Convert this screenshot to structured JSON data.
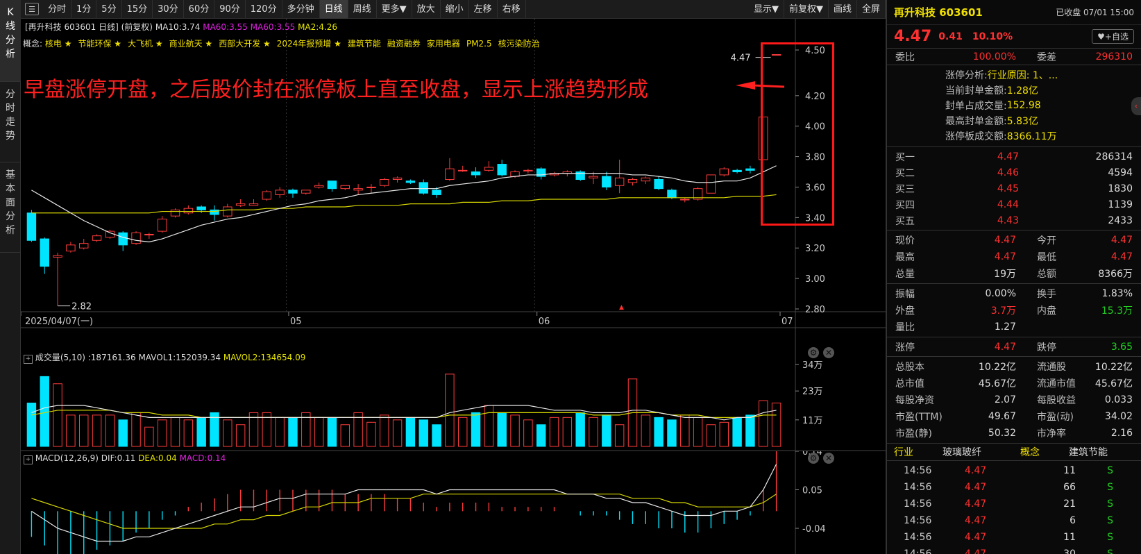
{
  "side_tabs": [
    "K线分析",
    "分时走势",
    "基本面分析"
  ],
  "toolbar": {
    "left_items": [
      "分时",
      "1分",
      "5分",
      "15分",
      "30分",
      "60分",
      "90分",
      "120分",
      "多分钟",
      "日线",
      "周线",
      "更多▼",
      "放大",
      "缩小",
      "左移",
      "右移"
    ],
    "active": "日线",
    "right_items": [
      "显示▼",
      "前复权▼",
      "画线",
      "全屏"
    ]
  },
  "stock_title": {
    "prefix": "[再升科技 603601 日线] (前复权)",
    "ma10": "MA10:3.74",
    "ma60": "MA60:3.55",
    "ma60b": "MA60:3.55",
    "ma2": "MA2:4.26"
  },
  "concepts": {
    "label": "概念:",
    "items": [
      "核电 ★",
      "节能环保 ★",
      "大飞机 ★",
      "商业航天 ★",
      "西部大开发 ★",
      "2024年报预增 ★",
      "建筑节能",
      "融资融券",
      "家用电器",
      "PM2.5",
      "核污染防治"
    ]
  },
  "annotation": "早盘涨停开盘，之后股价封在涨停板上直至收盘，显示上涨趋势形成",
  "price_axis": [
    "4.50",
    "4.20",
    "4.00",
    "3.80",
    "3.60",
    "3.40",
    "3.20",
    "3.00",
    "2.80"
  ],
  "date_axis": [
    "2025/04/07(一)",
    "05",
    "06",
    "07"
  ],
  "markers": {
    "high": "4.47",
    "low": "2.82"
  },
  "colors": {
    "up": "#ff3c3c",
    "down": "#00e5ff",
    "ma10": "#e8e8e8",
    "ma60": "#d6d600",
    "highlight": "#ff1818"
  },
  "volume_panel": {
    "label": "成交量(5,10)",
    "vol": ":187161.36",
    "mavol1": "MAVOL1:152039.34",
    "mavol2": "MAVOL2:134654.09",
    "axis": [
      "34万",
      "23万",
      "11万"
    ]
  },
  "macd_panel": {
    "label": "MACD(12,26,9)",
    "dif": "DIF:0.11",
    "dea": "DEA:0.04",
    "macd": "MACD:0.14",
    "axis": [
      "0.14",
      "0.05",
      "-0.04"
    ]
  },
  "chart_data": {
    "type": "candlestick",
    "ohlc": [
      [
        3.43,
        3.45,
        3.24,
        3.25
      ],
      [
        3.26,
        3.27,
        3.03,
        3.08
      ],
      [
        3.14,
        3.17,
        2.82,
        3.15
      ],
      [
        3.18,
        3.24,
        3.17,
        3.22
      ],
      [
        3.2,
        3.26,
        3.19,
        3.23
      ],
      [
        3.25,
        3.29,
        3.24,
        3.28
      ],
      [
        3.27,
        3.32,
        3.26,
        3.31
      ],
      [
        3.3,
        3.31,
        3.18,
        3.22
      ],
      [
        3.23,
        3.31,
        3.22,
        3.3
      ],
      [
        3.29,
        3.3,
        3.26,
        3.29
      ],
      [
        3.31,
        3.41,
        3.3,
        3.39
      ],
      [
        3.41,
        3.46,
        3.4,
        3.45
      ],
      [
        3.43,
        3.48,
        3.42,
        3.46
      ],
      [
        3.47,
        3.48,
        3.43,
        3.45
      ],
      [
        3.45,
        3.48,
        3.38,
        3.42
      ],
      [
        3.41,
        3.49,
        3.4,
        3.47
      ],
      [
        3.48,
        3.52,
        3.47,
        3.49
      ],
      [
        3.48,
        3.52,
        3.48,
        3.49
      ],
      [
        3.52,
        3.58,
        3.51,
        3.57
      ],
      [
        3.55,
        3.6,
        3.53,
        3.58
      ],
      [
        3.58,
        3.59,
        3.53,
        3.56
      ],
      [
        3.56,
        3.58,
        3.55,
        3.58
      ],
      [
        3.6,
        3.63,
        3.59,
        3.61
      ],
      [
        3.64,
        3.63,
        3.57,
        3.59
      ],
      [
        3.59,
        3.61,
        3.58,
        3.61
      ],
      [
        3.58,
        3.62,
        3.55,
        3.59
      ],
      [
        3.6,
        3.62,
        3.56,
        3.6
      ],
      [
        3.61,
        3.66,
        3.6,
        3.65
      ],
      [
        3.65,
        3.67,
        3.63,
        3.66
      ],
      [
        3.64,
        3.65,
        3.62,
        3.63
      ],
      [
        3.63,
        3.65,
        3.55,
        3.56
      ],
      [
        3.58,
        3.6,
        3.53,
        3.55
      ],
      [
        3.65,
        3.79,
        3.64,
        3.72
      ],
      [
        3.71,
        3.74,
        3.7,
        3.71
      ],
      [
        3.7,
        3.73,
        3.66,
        3.68
      ],
      [
        3.71,
        3.77,
        3.7,
        3.73
      ],
      [
        3.75,
        3.78,
        3.67,
        3.68
      ],
      [
        3.67,
        3.71,
        3.66,
        3.7
      ],
      [
        3.71,
        3.72,
        3.69,
        3.71
      ],
      [
        3.72,
        3.73,
        3.65,
        3.67
      ],
      [
        3.68,
        3.7,
        3.67,
        3.69
      ],
      [
        3.69,
        3.71,
        3.67,
        3.7
      ],
      [
        3.7,
        3.71,
        3.64,
        3.65
      ],
      [
        3.66,
        3.7,
        3.62,
        3.67
      ],
      [
        3.67,
        3.7,
        3.58,
        3.6
      ],
      [
        3.61,
        3.78,
        3.56,
        3.66
      ],
      [
        3.63,
        3.66,
        3.61,
        3.65
      ],
      [
        3.64,
        3.67,
        3.62,
        3.66
      ],
      [
        3.65,
        3.67,
        3.58,
        3.59
      ],
      [
        3.58,
        3.59,
        3.52,
        3.53
      ],
      [
        3.52,
        3.53,
        3.5,
        3.52
      ],
      [
        3.52,
        3.6,
        3.51,
        3.59
      ],
      [
        3.56,
        3.68,
        3.56,
        3.68
      ],
      [
        3.68,
        3.73,
        3.67,
        3.72
      ],
      [
        3.71,
        3.72,
        3.69,
        3.7
      ],
      [
        3.72,
        3.74,
        3.69,
        3.71
      ],
      [
        3.78,
        4.06,
        3.78,
        4.06
      ],
      [
        4.47,
        4.47,
        4.47,
        4.47
      ]
    ],
    "ma10": [
      3.58,
      3.53,
      3.48,
      3.43,
      3.38,
      3.34,
      3.3,
      3.27,
      3.25,
      3.24,
      3.26,
      3.29,
      3.32,
      3.35,
      3.37,
      3.39,
      3.4,
      3.42,
      3.44,
      3.46,
      3.48,
      3.49,
      3.51,
      3.52,
      3.53,
      3.55,
      3.56,
      3.57,
      3.58,
      3.59,
      3.59,
      3.59,
      3.61,
      3.62,
      3.63,
      3.64,
      3.66,
      3.67,
      3.68,
      3.68,
      3.69,
      3.69,
      3.69,
      3.69,
      3.69,
      3.69,
      3.68,
      3.68,
      3.67,
      3.66,
      3.64,
      3.63,
      3.63,
      3.64,
      3.64,
      3.66,
      3.7,
      3.74
    ],
    "ma60": [
      3.43,
      3.43,
      3.43,
      3.43,
      3.43,
      3.43,
      3.43,
      3.43,
      3.43,
      3.43,
      3.44,
      3.44,
      3.44,
      3.44,
      3.44,
      3.45,
      3.45,
      3.45,
      3.46,
      3.46,
      3.46,
      3.47,
      3.47,
      3.47,
      3.47,
      3.48,
      3.48,
      3.48,
      3.48,
      3.49,
      3.49,
      3.49,
      3.49,
      3.5,
      3.5,
      3.5,
      3.51,
      3.51,
      3.51,
      3.52,
      3.52,
      3.52,
      3.52,
      3.52,
      3.52,
      3.53,
      3.53,
      3.53,
      3.53,
      3.53,
      3.53,
      3.53,
      3.53,
      3.53,
      3.54,
      3.54,
      3.54,
      3.55
    ],
    "volume": [
      18,
      29,
      26,
      13,
      13,
      13,
      13,
      11,
      14,
      8,
      11,
      12,
      11,
      12,
      14,
      11,
      9,
      14,
      14,
      12,
      12,
      14,
      12,
      12,
      9,
      14,
      10,
      13,
      11,
      12,
      11,
      9,
      30,
      12,
      14,
      17,
      14,
      13,
      11,
      9,
      12,
      12,
      14,
      12,
      13,
      9,
      28,
      13,
      12,
      11,
      13,
      12,
      9,
      10,
      12,
      13,
      19,
      18
    ],
    "mavol1": [
      14,
      16,
      17,
      17,
      17,
      16,
      15,
      14,
      13,
      12,
      12,
      12,
      12,
      12,
      12,
      12,
      12,
      12,
      12,
      12,
      12,
      12,
      12,
      12,
      12,
      12,
      12,
      12,
      12,
      12,
      12,
      12,
      14,
      15,
      16,
      17,
      17,
      17,
      17,
      16,
      15,
      15,
      15,
      14,
      14,
      14,
      15,
      15,
      14,
      13,
      12,
      12,
      12,
      11,
      12,
      12,
      14,
      15
    ],
    "mavol2": [
      13,
      14,
      15,
      15,
      15,
      15,
      15,
      14,
      14,
      14,
      13,
      13,
      13,
      12,
      12,
      12,
      12,
      12,
      12,
      12,
      12,
      12,
      12,
      12,
      12,
      12,
      12,
      12,
      12,
      12,
      12,
      12,
      13,
      13,
      13,
      14,
      14,
      14,
      14,
      14,
      14,
      14,
      14,
      13,
      13,
      13,
      14,
      14,
      14,
      13,
      13,
      13,
      12,
      12,
      12,
      12,
      13,
      13
    ],
    "dif": [
      0.0,
      -0.02,
      -0.04,
      -0.05,
      -0.06,
      -0.07,
      -0.07,
      -0.07,
      -0.06,
      -0.06,
      -0.05,
      -0.04,
      -0.03,
      -0.02,
      -0.01,
      -0.0,
      0.01,
      0.01,
      0.02,
      0.03,
      0.03,
      0.04,
      0.04,
      0.04,
      0.04,
      0.05,
      0.05,
      0.05,
      0.05,
      0.05,
      0.05,
      0.04,
      0.05,
      0.05,
      0.05,
      0.05,
      0.05,
      0.05,
      0.05,
      0.05,
      0.05,
      0.04,
      0.04,
      0.04,
      0.03,
      0.03,
      0.02,
      0.02,
      0.01,
      0.0,
      -0.01,
      -0.01,
      -0.01,
      0.0,
      0.0,
      0.01,
      0.05,
      0.11
    ],
    "dea": [
      0.03,
      0.02,
      0.01,
      -0.0,
      -0.01,
      -0.02,
      -0.03,
      -0.04,
      -0.04,
      -0.04,
      -0.04,
      -0.04,
      -0.04,
      -0.04,
      -0.03,
      -0.03,
      -0.02,
      -0.02,
      -0.01,
      -0.01,
      0.0,
      0.01,
      0.01,
      0.02,
      0.02,
      0.02,
      0.03,
      0.03,
      0.03,
      0.03,
      0.04,
      0.04,
      0.04,
      0.04,
      0.04,
      0.04,
      0.04,
      0.04,
      0.04,
      0.04,
      0.04,
      0.04,
      0.04,
      0.04,
      0.04,
      0.04,
      0.03,
      0.03,
      0.03,
      0.02,
      0.02,
      0.01,
      0.01,
      0.01,
      0.01,
      0.01,
      0.02,
      0.04
    ],
    "macd": [
      -0.06,
      -0.08,
      -0.1,
      -0.1,
      -0.1,
      -0.09,
      -0.08,
      -0.07,
      -0.05,
      -0.04,
      -0.02,
      -0.01,
      0.01,
      0.02,
      0.03,
      0.04,
      0.05,
      0.05,
      0.05,
      0.05,
      0.05,
      0.05,
      0.05,
      0.05,
      0.04,
      0.04,
      0.04,
      0.04,
      0.03,
      0.03,
      0.02,
      0.01,
      0.02,
      0.02,
      0.02,
      0.02,
      0.01,
      0.01,
      0.01,
      0.01,
      0.01,
      0.0,
      -0.01,
      -0.01,
      -0.01,
      -0.02,
      -0.03,
      -0.03,
      -0.04,
      -0.04,
      -0.05,
      -0.05,
      -0.04,
      -0.03,
      -0.02,
      -0.01,
      0.05,
      0.14
    ],
    "ylim_price": [
      2.8,
      4.5
    ],
    "ylim_volume": [
      0,
      34
    ],
    "ylim_macd": [
      -0.1,
      0.14
    ]
  },
  "quote": {
    "name": "再升科技 603601",
    "status": "已收盘 07/01 15:00",
    "price": "4.47",
    "change": "0.41",
    "pct": "10.10%",
    "watch": "♥+自选",
    "weibi_label": "委比",
    "weibi": "100.00%",
    "weicha_label": "委差",
    "weicha": "296310",
    "limit_up": [
      {
        "label": "涨停分析:",
        "value": "行业原因: 1、..."
      },
      {
        "label": "当前封单金额:",
        "value": "1.28亿"
      },
      {
        "label": "封单占成交量:",
        "value": "152.98"
      },
      {
        "label": "最高封单金额:",
        "value": "5.83亿"
      },
      {
        "label": "涨停板成交额:",
        "value": "8366.11万"
      }
    ],
    "orderbook": [
      {
        "label": "买一",
        "price": "4.47",
        "vol": "286314"
      },
      {
        "label": "买二",
        "price": "4.46",
        "vol": "4594"
      },
      {
        "label": "买三",
        "price": "4.45",
        "vol": "1830"
      },
      {
        "label": "买四",
        "price": "4.44",
        "vol": "1139"
      },
      {
        "label": "买五",
        "price": "4.43",
        "vol": "2433"
      }
    ],
    "stats": [
      {
        "l1": "现价",
        "v1": "4.47",
        "c1": "red",
        "l2": "今开",
        "v2": "4.47",
        "c2": "red"
      },
      {
        "l1": "最高",
        "v1": "4.47",
        "c1": "red",
        "l2": "最低",
        "v2": "4.47",
        "c2": "red"
      },
      {
        "l1": "总量",
        "v1": "19万",
        "c1": "white",
        "l2": "总额",
        "v2": "8366万",
        "c2": "white"
      }
    ],
    "stats2": [
      {
        "l1": "振幅",
        "v1": "0.00%",
        "c1": "white",
        "l2": "换手",
        "v2": "1.83%",
        "c2": "white"
      },
      {
        "l1": "外盘",
        "v1": "3.7万",
        "c1": "red",
        "l2": "内盘",
        "v2": "15.3万",
        "c2": "green"
      },
      {
        "l1": "量比",
        "v1": "1.27",
        "c1": "white",
        "l2": "",
        "v2": "",
        "c2": "white"
      }
    ],
    "limits": {
      "l1": "涨停",
      "v1": "4.47",
      "l2": "跌停",
      "v2": "3.65"
    },
    "fundamentals": [
      {
        "l1": "总股本",
        "v1": "10.22亿",
        "l2": "流通股",
        "v2": "10.22亿"
      },
      {
        "l1": "总市值",
        "v1": "45.67亿",
        "l2": "流通市值",
        "v2": "45.67亿"
      },
      {
        "l1": "每股净资",
        "v1": "2.07",
        "l2": "每股收益",
        "v2": "0.033"
      },
      {
        "l1": "市盈(TTM)",
        "v1": "49.67",
        "l2": "市盈(动)",
        "v2": "34.02"
      },
      {
        "l1": "市盈(静)",
        "v1": "50.32",
        "l2": "市净率",
        "v2": "2.16"
      }
    ],
    "industry": {
      "label": "行业",
      "value": "玻璃玻纤",
      "concept_label": "概念",
      "concept": "建筑节能"
    },
    "ticks": [
      {
        "time": "14:56",
        "price": "4.47",
        "vol": "11",
        "side": "S"
      },
      {
        "time": "14:56",
        "price": "4.47",
        "vol": "66",
        "side": "S"
      },
      {
        "time": "14:56",
        "price": "4.47",
        "vol": "21",
        "side": "S"
      },
      {
        "time": "14:56",
        "price": "4.47",
        "vol": "6",
        "side": "S"
      },
      {
        "time": "14:56",
        "price": "4.47",
        "vol": "11",
        "side": "S"
      },
      {
        "time": "14:56",
        "price": "4.47",
        "vol": "30",
        "side": "S"
      }
    ]
  }
}
